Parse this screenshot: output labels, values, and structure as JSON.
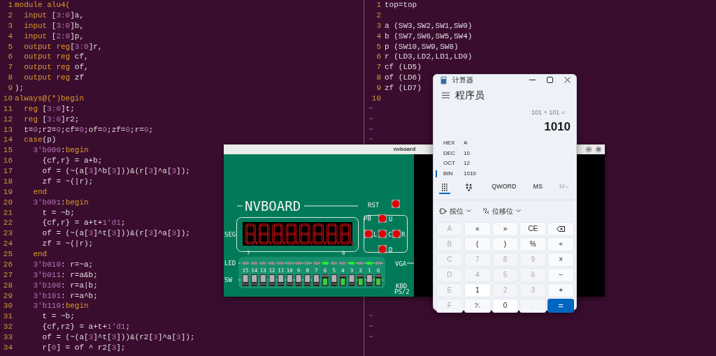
{
  "left_editor": {
    "lines": [
      {
        "number": "1",
        "segments": [
          {
            "kind": "keyword",
            "text": "module alu4("
          }
        ]
      },
      {
        "number": "2",
        "segments": [
          {
            "kind": "keyword",
            "text": "  input"
          },
          {
            "kind": "plain",
            "text": " ["
          },
          {
            "kind": "number",
            "text": "3:0"
          },
          {
            "kind": "plain",
            "text": "]a,"
          }
        ]
      },
      {
        "number": "3",
        "segments": [
          {
            "kind": "keyword",
            "text": "  input"
          },
          {
            "kind": "plain",
            "text": " ["
          },
          {
            "kind": "number",
            "text": "3:0"
          },
          {
            "kind": "plain",
            "text": "]b,"
          }
        ]
      },
      {
        "number": "4",
        "segments": [
          {
            "kind": "keyword",
            "text": "  input"
          },
          {
            "kind": "plain",
            "text": " ["
          },
          {
            "kind": "number",
            "text": "2:0"
          },
          {
            "kind": "plain",
            "text": "]p,"
          }
        ]
      },
      {
        "number": "5",
        "segments": [
          {
            "kind": "keyword",
            "text": "  output reg"
          },
          {
            "kind": "plain",
            "text": "["
          },
          {
            "kind": "number",
            "text": "3:0"
          },
          {
            "kind": "plain",
            "text": "]r,"
          }
        ]
      },
      {
        "number": "6",
        "segments": [
          {
            "kind": "keyword",
            "text": "  output reg"
          },
          {
            "kind": "plain",
            "text": " cf,"
          }
        ]
      },
      {
        "number": "7",
        "segments": [
          {
            "kind": "keyword",
            "text": "  output reg"
          },
          {
            "kind": "plain",
            "text": " of,"
          }
        ]
      },
      {
        "number": "8",
        "segments": [
          {
            "kind": "keyword",
            "text": "  output reg"
          },
          {
            "kind": "plain",
            "text": " zf"
          }
        ]
      },
      {
        "number": "9",
        "segments": [
          {
            "kind": "plain",
            "text": ");"
          }
        ]
      },
      {
        "number": "10",
        "segments": [
          {
            "kind": "keyword",
            "text": "always@(*)begin"
          }
        ]
      },
      {
        "number": "11",
        "segments": [
          {
            "kind": "keyword",
            "text": "  reg"
          },
          {
            "kind": "plain",
            "text": " ["
          },
          {
            "kind": "number",
            "text": "3:0"
          },
          {
            "kind": "plain",
            "text": "]t;"
          }
        ]
      },
      {
        "number": "12",
        "segments": [
          {
            "kind": "keyword",
            "text": "  reg"
          },
          {
            "kind": "plain",
            "text": " ["
          },
          {
            "kind": "number",
            "text": "3:0"
          },
          {
            "kind": "plain",
            "text": "]r2;"
          }
        ]
      },
      {
        "number": "13",
        "segments": [
          {
            "kind": "plain",
            "text": "  t="
          },
          {
            "kind": "number",
            "text": "0"
          },
          {
            "kind": "plain",
            "text": ";r2="
          },
          {
            "kind": "number",
            "text": "0"
          },
          {
            "kind": "plain",
            "text": ";cf="
          },
          {
            "kind": "number",
            "text": "0"
          },
          {
            "kind": "plain",
            "text": ";of="
          },
          {
            "kind": "number",
            "text": "0"
          },
          {
            "kind": "plain",
            "text": ";zf="
          },
          {
            "kind": "number",
            "text": "0"
          },
          {
            "kind": "plain",
            "text": ";r="
          },
          {
            "kind": "number",
            "text": "0"
          },
          {
            "kind": "plain",
            "text": ";"
          }
        ]
      },
      {
        "number": "14",
        "segments": [
          {
            "kind": "keyword",
            "text": "  case"
          },
          {
            "kind": "plain",
            "text": "(p)"
          }
        ]
      },
      {
        "number": "15",
        "segments": [
          {
            "kind": "number",
            "text": "    3'b000"
          },
          {
            "kind": "plain",
            "text": ":"
          },
          {
            "kind": "keyword",
            "text": "begin"
          }
        ]
      },
      {
        "number": "16",
        "segments": [
          {
            "kind": "plain",
            "text": "      {cf,r} = a+b;"
          }
        ]
      },
      {
        "number": "17",
        "segments": [
          {
            "kind": "plain",
            "text": "      of = (~(a["
          },
          {
            "kind": "number",
            "text": "3"
          },
          {
            "kind": "plain",
            "text": "]^b["
          },
          {
            "kind": "number",
            "text": "3"
          },
          {
            "kind": "plain",
            "text": "]))&(r["
          },
          {
            "kind": "number",
            "text": "3"
          },
          {
            "kind": "plain",
            "text": "]^a["
          },
          {
            "kind": "number",
            "text": "3"
          },
          {
            "kind": "plain",
            "text": "]);"
          }
        ]
      },
      {
        "number": "18",
        "segments": [
          {
            "kind": "plain",
            "text": "      zf = ~(|r);"
          }
        ]
      },
      {
        "number": "19",
        "segments": [
          {
            "kind": "keyword",
            "text": "    end"
          }
        ]
      },
      {
        "number": "20",
        "segments": [
          {
            "kind": "number",
            "text": "    3'b001"
          },
          {
            "kind": "plain",
            "text": ":"
          },
          {
            "kind": "keyword",
            "text": "begin"
          }
        ]
      },
      {
        "number": "21",
        "segments": [
          {
            "kind": "plain",
            "text": "      t = ~b;"
          }
        ]
      },
      {
        "number": "22",
        "segments": [
          {
            "kind": "plain",
            "text": "      {cf,r} = a+t+"
          },
          {
            "kind": "number",
            "text": "1'd1"
          },
          {
            "kind": "plain",
            "text": ";"
          }
        ]
      },
      {
        "number": "23",
        "segments": [
          {
            "kind": "plain",
            "text": "      of = (~(a["
          },
          {
            "kind": "number",
            "text": "3"
          },
          {
            "kind": "plain",
            "text": "]^t["
          },
          {
            "kind": "number",
            "text": "3"
          },
          {
            "kind": "plain",
            "text": "]))&(r["
          },
          {
            "kind": "number",
            "text": "3"
          },
          {
            "kind": "plain",
            "text": "]^a["
          },
          {
            "kind": "number",
            "text": "3"
          },
          {
            "kind": "plain",
            "text": "]);"
          }
        ]
      },
      {
        "number": "24",
        "segments": [
          {
            "kind": "plain",
            "text": "      zf = ~(|r);"
          }
        ]
      },
      {
        "number": "25",
        "segments": [
          {
            "kind": "keyword",
            "text": "    end"
          }
        ]
      },
      {
        "number": "26",
        "segments": [
          {
            "kind": "number",
            "text": "    3'b010"
          },
          {
            "kind": "plain",
            "text": ": r=~a;"
          }
        ]
      },
      {
        "number": "27",
        "segments": [
          {
            "kind": "number",
            "text": "    3'b011"
          },
          {
            "kind": "plain",
            "text": ": r=a&b;"
          }
        ]
      },
      {
        "number": "28",
        "segments": [
          {
            "kind": "number",
            "text": "    3'b100"
          },
          {
            "kind": "plain",
            "text": ": r=a|b;"
          }
        ]
      },
      {
        "number": "29",
        "segments": [
          {
            "kind": "number",
            "text": "    3'b101"
          },
          {
            "kind": "plain",
            "text": ": r=a^b;"
          }
        ]
      },
      {
        "number": "30",
        "segments": [
          {
            "kind": "number",
            "text": "    3'b110"
          },
          {
            "kind": "plain",
            "text": ":"
          },
          {
            "kind": "keyword",
            "text": "begin"
          }
        ]
      },
      {
        "number": "31",
        "segments": [
          {
            "kind": "plain",
            "text": "      t = ~b;"
          }
        ]
      },
      {
        "number": "32",
        "segments": [
          {
            "kind": "plain",
            "text": "      {cf,r2} = a+t+"
          },
          {
            "kind": "number",
            "text": "1'd1"
          },
          {
            "kind": "plain",
            "text": ";"
          }
        ]
      },
      {
        "number": "33",
        "segments": [
          {
            "kind": "plain",
            "text": "      of = (~(a["
          },
          {
            "kind": "number",
            "text": "3"
          },
          {
            "kind": "plain",
            "text": "]^t["
          },
          {
            "kind": "number",
            "text": "3"
          },
          {
            "kind": "plain",
            "text": "]))&(r2["
          },
          {
            "kind": "number",
            "text": "3"
          },
          {
            "kind": "plain",
            "text": "]^a["
          },
          {
            "kind": "number",
            "text": "3"
          },
          {
            "kind": "plain",
            "text": "]);"
          }
        ]
      },
      {
        "number": "34",
        "segments": [
          {
            "kind": "plain",
            "text": "      r["
          },
          {
            "kind": "number",
            "text": "0"
          },
          {
            "kind": "plain",
            "text": "] = of ^ r2["
          },
          {
            "kind": "number",
            "text": "3"
          },
          {
            "kind": "plain",
            "text": "];"
          }
        ]
      }
    ]
  },
  "right_editor": {
    "lines": [
      {
        "number": "1",
        "text": "top=top"
      },
      {
        "number": "2"
      },
      {
        "number": "3",
        "text": "a (SW3,SW2,SW1,SW0)"
      },
      {
        "number": "4",
        "text": "b (SW7,SW6,SW5,SW4)"
      },
      {
        "number": "5",
        "text": "p (SW10,SW9,SW8)"
      },
      {
        "number": "6",
        "text": "r (LD3,LD2,LD1,LD0)"
      },
      {
        "number": "7",
        "text": "cf (LD5)"
      },
      {
        "number": "8",
        "text": "of (LD6)"
      },
      {
        "number": "9",
        "text": "zf (LD7)"
      },
      {
        "number": "10"
      }
    ],
    "tildes_top": [
      "~",
      "~",
      "~",
      "~"
    ],
    "tildes_bottom": [
      "~",
      "~",
      "~"
    ]
  },
  "nvboard": {
    "title": "nvboard",
    "logo": "NVBOARD",
    "rst_label": "RST",
    "seg_label": "SEG",
    "seg_left_index": "7",
    "seg_right_index": "0",
    "pb_label": "PB",
    "buttons": [
      {
        "label": "U"
      },
      {
        "label": "L"
      },
      {
        "label": "C"
      },
      {
        "label": "R"
      },
      {
        "label": "D"
      }
    ],
    "led_label": "LED",
    "sw_label": "SW",
    "vga_label": "VGA",
    "kbd_label": "KBD",
    "ps2_label": "PS/2",
    "leds": [
      {
        "on": false
      },
      {
        "on": false
      },
      {
        "on": false
      },
      {
        "on": false
      },
      {
        "on": false
      },
      {
        "on": false
      },
      {
        "on": false
      },
      {
        "on": false
      },
      {
        "on": false
      },
      {
        "on": true
      },
      {
        "on": false
      },
      {
        "on": false
      },
      {
        "on": true
      },
      {
        "on": false
      },
      {
        "on": true
      },
      {
        "on": false
      }
    ],
    "switches": [
      {
        "label": "15",
        "on": false
      },
      {
        "label": "14",
        "on": false
      },
      {
        "label": "13",
        "on": false
      },
      {
        "label": "12",
        "on": false
      },
      {
        "label": "11",
        "on": false
      },
      {
        "label": "10",
        "on": false
      },
      {
        "label": "9",
        "on": false
      },
      {
        "label": "8",
        "on": false
      },
      {
        "label": "7",
        "on": false
      },
      {
        "label": "6",
        "on": true
      },
      {
        "label": "5",
        "on": false
      },
      {
        "label": "4",
        "on": true
      },
      {
        "label": "3",
        "on": false
      },
      {
        "label": "2",
        "on": true
      },
      {
        "label": "1",
        "on": false
      },
      {
        "label": "0",
        "on": true
      }
    ]
  },
  "calculator": {
    "title": "计算器",
    "mode": "程序员",
    "expression": "101 + 101 =",
    "result": "1010",
    "radixes": [
      {
        "name": "HEX",
        "value": "A",
        "selected": false
      },
      {
        "name": "DEC",
        "value": "10",
        "selected": false
      },
      {
        "name": "OCT",
        "value": "12",
        "selected": false
      },
      {
        "name": "BIN",
        "value": "1010",
        "selected": true
      }
    ],
    "toolbar": [
      {
        "kind": "keypad",
        "selected": true,
        "disabled": false
      },
      {
        "kind": "bits",
        "selected": false,
        "disabled": false
      },
      {
        "kind": "text",
        "label": "QWORD",
        "selected": false,
        "disabled": false
      },
      {
        "kind": "text",
        "label": "MS",
        "selected": false,
        "disabled": false
      },
      {
        "kind": "menu",
        "label": "M",
        "selected": false,
        "disabled": true
      }
    ],
    "menus": [
      {
        "kind": "gate",
        "label": "按位"
      },
      {
        "kind": "shift",
        "label": "位移位"
      }
    ],
    "keys": [
      {
        "label": "A",
        "kind": "number",
        "disabled": true
      },
      {
        "label": "«",
        "kind": "operator",
        "disabled": false
      },
      {
        "label": "»",
        "kind": "operator",
        "disabled": false
      },
      {
        "label": "CE",
        "kind": "operator",
        "disabled": false
      },
      {
        "kind": "backspace",
        "disabled": false
      },
      {
        "label": "B",
        "kind": "number",
        "disabled": true
      },
      {
        "label": "(",
        "kind": "operator",
        "disabled": false
      },
      {
        "label": ")",
        "kind": "operator",
        "disabled": false
      },
      {
        "label": "%",
        "kind": "operator",
        "disabled": false
      },
      {
        "label": "÷",
        "kind": "operator",
        "disabled": false
      },
      {
        "label": "C",
        "kind": "number",
        "disabled": true
      },
      {
        "label": "7",
        "kind": "number",
        "disabled": true
      },
      {
        "label": "8",
        "kind": "number",
        "disabled": true
      },
      {
        "label": "9",
        "kind": "number",
        "disabled": true
      },
      {
        "label": "×",
        "kind": "operator",
        "disabled": false
      },
      {
        "label": "D",
        "kind": "number",
        "disabled": true
      },
      {
        "label": "4",
        "kind": "number",
        "disabled": true
      },
      {
        "label": "5",
        "kind": "number",
        "disabled": true
      },
      {
        "label": "6",
        "kind": "number",
        "disabled": true
      },
      {
        "label": "−",
        "kind": "operator",
        "disabled": false
      },
      {
        "label": "E",
        "kind": "number",
        "disabled": true
      },
      {
        "label": "1",
        "kind": "number",
        "disabled": false
      },
      {
        "label": "2",
        "kind": "number",
        "disabled": true
      },
      {
        "label": "3",
        "kind": "number",
        "disabled": true
      },
      {
        "label": "+",
        "kind": "operator",
        "disabled": false
      },
      {
        "label": "F",
        "kind": "number",
        "disabled": true
      },
      {
        "label": "⁺∕₋",
        "kind": "operator",
        "disabled": false
      },
      {
        "label": "0",
        "kind": "number",
        "disabled": false
      },
      {
        "label": ".",
        "kind": "number",
        "disabled": true
      },
      {
        "label": "=",
        "kind": "equals",
        "disabled": false
      }
    ]
  }
}
